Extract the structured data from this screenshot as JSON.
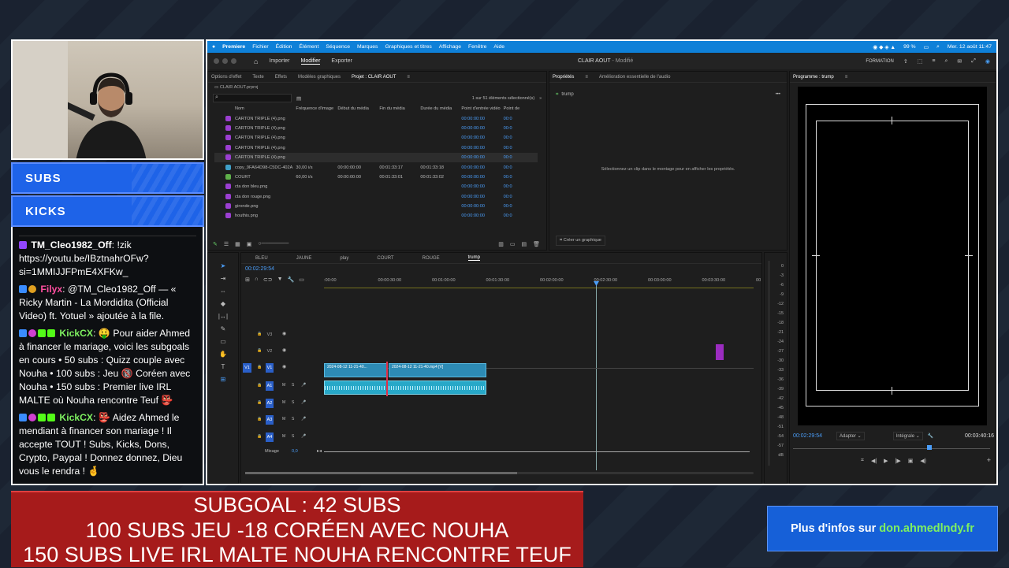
{
  "sidebar": {
    "subs_label": "SUBS",
    "kicks_label": "KICKS"
  },
  "chat": {
    "messages": [
      {
        "user": "TM_Cleo1982_Off",
        "user_color": "#ffffff",
        "text": ": !zik https://youtu.be/IBztnahrOFw?si=1MMIJJFPmE4XFKw_"
      },
      {
        "user": "Filyx",
        "user_color": "#ff4fa0",
        "text": ": @TM_Cleo1982_Off — « Ricky Martin - La Mordidita (Official Video) ft. Yotuel » ajoutée à la file."
      },
      {
        "user": "KickCX",
        "user_color": "#7ef060",
        "text": ": 🤑 Pour aider Ahmed à financer le mariage, voici les subgoals en cours • 50 subs : Quizz couple avec Nouha • 100 subs : Jeu 🔞 Coréen avec Nouha • 150 subs : Premier live IRL MALTE où Nouha rencontre Teuf 👺"
      },
      {
        "user": "KickCX",
        "user_color": "#7ef060",
        "text": ": 👺 Aidez Ahmed le mendiant à financer son mariage ! Il accepte TOUT ! Subs, Kicks, Dons, Crypto, Paypal ! Donnez donnez, Dieu vous le rendra ! 🤞"
      }
    ]
  },
  "premiere": {
    "menu": [
      "Premiere",
      "Fichier",
      "Édition",
      "Élément",
      "Séquence",
      "Marques",
      "Graphiques et titres",
      "Affichage",
      "Fenêtre",
      "Aide"
    ],
    "battery": "99 %",
    "datetime": "Mer. 12 août  11:47",
    "nav_tabs": [
      "Importer",
      "Modifier",
      "Exporter"
    ],
    "active_nav": "Modifier",
    "doc_title": "CLAIR AOUT",
    "doc_status": "- Modifié",
    "workspace": "FORMATION",
    "project_tabs": [
      "Options d'effet",
      "Texte",
      "Effets",
      "Modèles graphiques",
      "Projet : CLAIR AOUT"
    ],
    "project_file": "CLAIR AOUT.prproj",
    "selection_info": "1 sur 51 éléments sélectionné(s)",
    "columns": [
      "Nom",
      "Fréquence d'image",
      "Début du média",
      "Fin du média",
      "Durée du média",
      "Point d'entrée vidéo",
      "Point de"
    ],
    "rows": [
      {
        "name": "CARTON TRIPLE (4).png",
        "fps": "",
        "start": "",
        "end": "",
        "dur": "",
        "in": "00:00:00:00",
        "pt": "00:0",
        "color": "#9b3fd1"
      },
      {
        "name": "CARTON TRIPLE (4).png",
        "fps": "",
        "start": "",
        "end": "",
        "dur": "",
        "in": "00:00:00:00",
        "pt": "00:0",
        "color": "#9b3fd1"
      },
      {
        "name": "CARTON TRIPLE (4).png",
        "fps": "",
        "start": "",
        "end": "",
        "dur": "",
        "in": "00:00:00:00",
        "pt": "00:0",
        "color": "#9b3fd1"
      },
      {
        "name": "CARTON TRIPLE (4).png",
        "fps": "",
        "start": "",
        "end": "",
        "dur": "",
        "in": "00:00:00:00",
        "pt": "00:0",
        "color": "#9b3fd1"
      },
      {
        "name": "CARTON TRIPLE (4).png",
        "fps": "",
        "start": "",
        "end": "",
        "dur": "",
        "in": "00:00:00:00",
        "pt": "00:0",
        "color": "#9b3fd1"
      },
      {
        "name": "copy_9FA64D98-C5DC-402A",
        "fps": "30,00 i/s",
        "start": "00:00:00:00",
        "end": "00:01:33:17",
        "dur": "00:01:33:18",
        "in": "00:00:00:00",
        "pt": "00:0",
        "color": "#3fa0c8"
      },
      {
        "name": "COURT",
        "fps": "60,00 i/s",
        "start": "00:00:00:00",
        "end": "00:01:33:01",
        "dur": "00:01:33:02",
        "in": "00:00:00:00",
        "pt": "00:0",
        "color": "#5fb04a"
      },
      {
        "name": "cta don bleu.png",
        "fps": "",
        "start": "",
        "end": "",
        "dur": "",
        "in": "00:00:00:00",
        "pt": "00:0",
        "color": "#9b3fd1"
      },
      {
        "name": "cta don rouge.png",
        "fps": "",
        "start": "",
        "end": "",
        "dur": "",
        "in": "00:00:00:00",
        "pt": "00:0",
        "color": "#9b3fd1"
      },
      {
        "name": "gironde.png",
        "fps": "",
        "start": "",
        "end": "",
        "dur": "",
        "in": "00:00:00:00",
        "pt": "00:0",
        "color": "#9b3fd1"
      },
      {
        "name": "houthis.png",
        "fps": "",
        "start": "",
        "end": "",
        "dur": "",
        "in": "00:00:00:00",
        "pt": "00:0",
        "color": "#9b3fd1"
      }
    ],
    "properties_tabs": [
      "Propriétés",
      "Amélioration essentielle de l'audio"
    ],
    "properties_item": "trump",
    "properties_hint": "Sélectionnez un clip dans le montage pour en afficher les propriétés.",
    "create_graphic": "Créer un graphique",
    "program_title": "Programme : trump",
    "program_timecode": "00:02:29:54",
    "fit_option": "Adapter",
    "quality_option": "Intégrale",
    "program_duration": "00:03:40:16",
    "seq_tabs": [
      "BLEU",
      "JAUNE",
      "play",
      "COURT",
      "ROUGE",
      "trump"
    ],
    "active_seq": "trump",
    "seq_timecode": "00:02:29:54",
    "ruler_labels": [
      ":00:00",
      "00:00:30:00",
      "00:01:00:00",
      "00:01:30:00",
      "00:02:00:00",
      "00:02:30:00",
      "00:03:00:00",
      "00:03:30:00",
      "00"
    ],
    "video_tracks": [
      "V3",
      "V2",
      "V1"
    ],
    "audio_tracks": [
      "A1",
      "A2",
      "A3",
      "A4"
    ],
    "mix_label": "Mixage",
    "mix_value": "0,0",
    "clip_a": "2024-08-12 11-21-40...",
    "clip_b": "2024-08-12 11-21-40.mp4 [V]",
    "vu_labels": [
      "0",
      "-3",
      "-6",
      "-9",
      "-12",
      "-15",
      "-18",
      "-21",
      "-24",
      "-27",
      "-30",
      "-33",
      "-36",
      "-39",
      "-42",
      "-45",
      "-48",
      "-51",
      "-54",
      "-57",
      "dB"
    ]
  },
  "banner": {
    "line1": "SUBGOAL : 42 SUBS",
    "line2": "100 SUBS JEU -18 CORÉEN AVEC NOUHA",
    "line3": "150 SUBS LIVE IRL MALTE NOUHA RENCONTRE TEUF"
  },
  "info": {
    "prefix": "Plus d'infos sur",
    "url": "don.ahmedlndy.fr"
  }
}
